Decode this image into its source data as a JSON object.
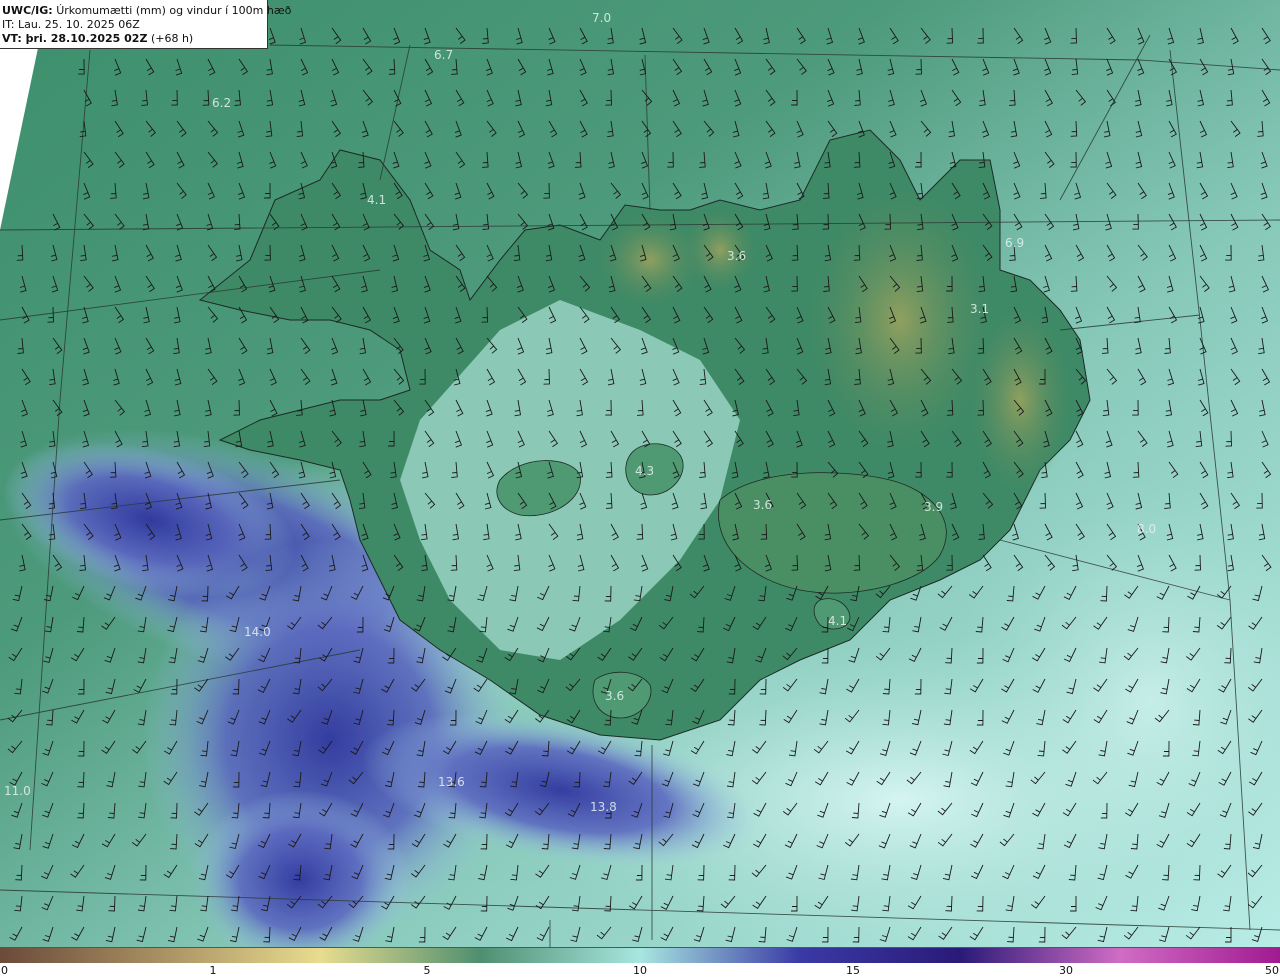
{
  "header": {
    "line1_prefix": "UWC/IG:",
    "line1_text": "Úrkomumætti (mm) og vindur í 100m hæð",
    "line2": "IT: Lau. 25. 10. 2025 06Z",
    "line3_prefix": "VT: þri. 28.10.2025 02Z",
    "line3_suffix": "(+68 h)"
  },
  "map_labels": [
    {
      "text": "7.0"
    },
    {
      "text": "6.7"
    },
    {
      "text": "6.2"
    },
    {
      "text": "4.1"
    },
    {
      "text": "3.6"
    },
    {
      "text": "6.9"
    },
    {
      "text": "3.1"
    },
    {
      "text": "4.3"
    },
    {
      "text": "3.6"
    },
    {
      "text": "3.9"
    },
    {
      "text": "8.0"
    },
    {
      "text": "4.1"
    },
    {
      "text": "14.0"
    },
    {
      "text": "3.6"
    },
    {
      "text": "13.6"
    },
    {
      "text": "13.8"
    },
    {
      "text": "11.0"
    }
  ],
  "colorbar": {
    "ticks": [
      "0",
      "1",
      "5",
      "10",
      "15",
      "30",
      "50"
    ],
    "stops": [
      "#6b4a3a",
      "#a89062",
      "#e8dc8e",
      "#4f8f70",
      "#a8e6e0",
      "#3a3aa6",
      "#2a1a78",
      "#d06cc4",
      "#a01a90"
    ]
  },
  "colors": {
    "land_dark": "#3f7f5c",
    "land_high": "#8a9a5a",
    "sea_north": "#4f9a7e",
    "sea_light": "#a8e0d8",
    "precip_heavy": "#3c40a8"
  }
}
